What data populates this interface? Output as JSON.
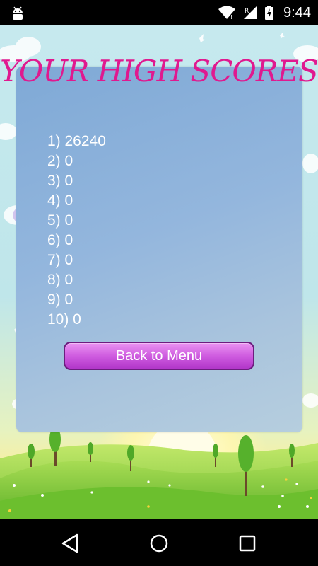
{
  "status_bar": {
    "time": "9:44",
    "icons": [
      "android-debug-icon",
      "wifi-icon",
      "signal-roaming-icon",
      "battery-charging-icon"
    ]
  },
  "screen": {
    "title": "YOUR HIGH SCORES",
    "scores": [
      "1) 26240",
      "2) 0",
      "3) 0",
      "4) 0",
      "5) 0",
      "6) 0",
      "7) 0",
      "8) 0",
      "9) 0",
      "10) 0"
    ],
    "back_button_label": "Back to Menu"
  },
  "nav_bar": {
    "buttons": [
      "back-icon",
      "home-icon",
      "recents-icon"
    ]
  },
  "colors": {
    "title": "#e0198f",
    "panel": "#8fb3da",
    "button": "#cf5ce0",
    "sky": "#c6e9ee",
    "grass": "#8cce3a"
  }
}
